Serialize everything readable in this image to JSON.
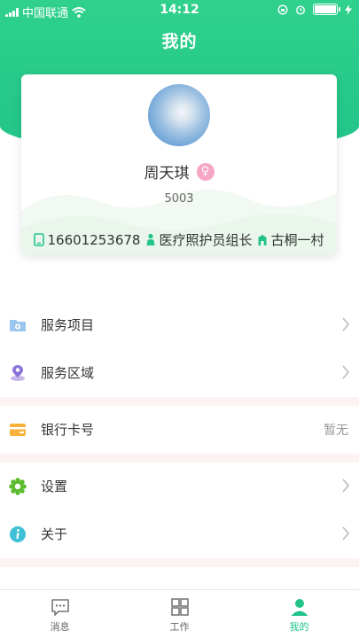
{
  "status_bar": {
    "carrier": "中国联通",
    "time": "14:12"
  },
  "header": {
    "title": "我的"
  },
  "profile": {
    "name": "周天琪",
    "gender_icon": "female-icon",
    "gender_symbol": "♀",
    "employee_id": "5003",
    "phone": "16601253678",
    "role": "医疗照护员组长",
    "location": "古桐一村"
  },
  "menu_groups": [
    {
      "items": [
        {
          "label": "服务项目",
          "icon": "folder-gear-icon"
        },
        {
          "label": "服务区域",
          "icon": "location-pin-icon"
        }
      ]
    },
    {
      "items": [
        {
          "label": "银行卡号",
          "icon": "bank-card-icon",
          "value": "暂无"
        }
      ]
    },
    {
      "items": [
        {
          "label": "设置",
          "icon": "gear-icon"
        },
        {
          "label": "关于",
          "icon": "info-icon"
        }
      ]
    }
  ],
  "tabbar": {
    "tabs": [
      {
        "label": "消息",
        "icon": "message-icon"
      },
      {
        "label": "工作",
        "icon": "grid-icon"
      },
      {
        "label": "我的",
        "icon": "person-icon",
        "active": true
      }
    ]
  },
  "colors": {
    "brand_green": "#22c48a",
    "gender_pink": "#f6a5c4",
    "separator": "#fdf2f2"
  }
}
